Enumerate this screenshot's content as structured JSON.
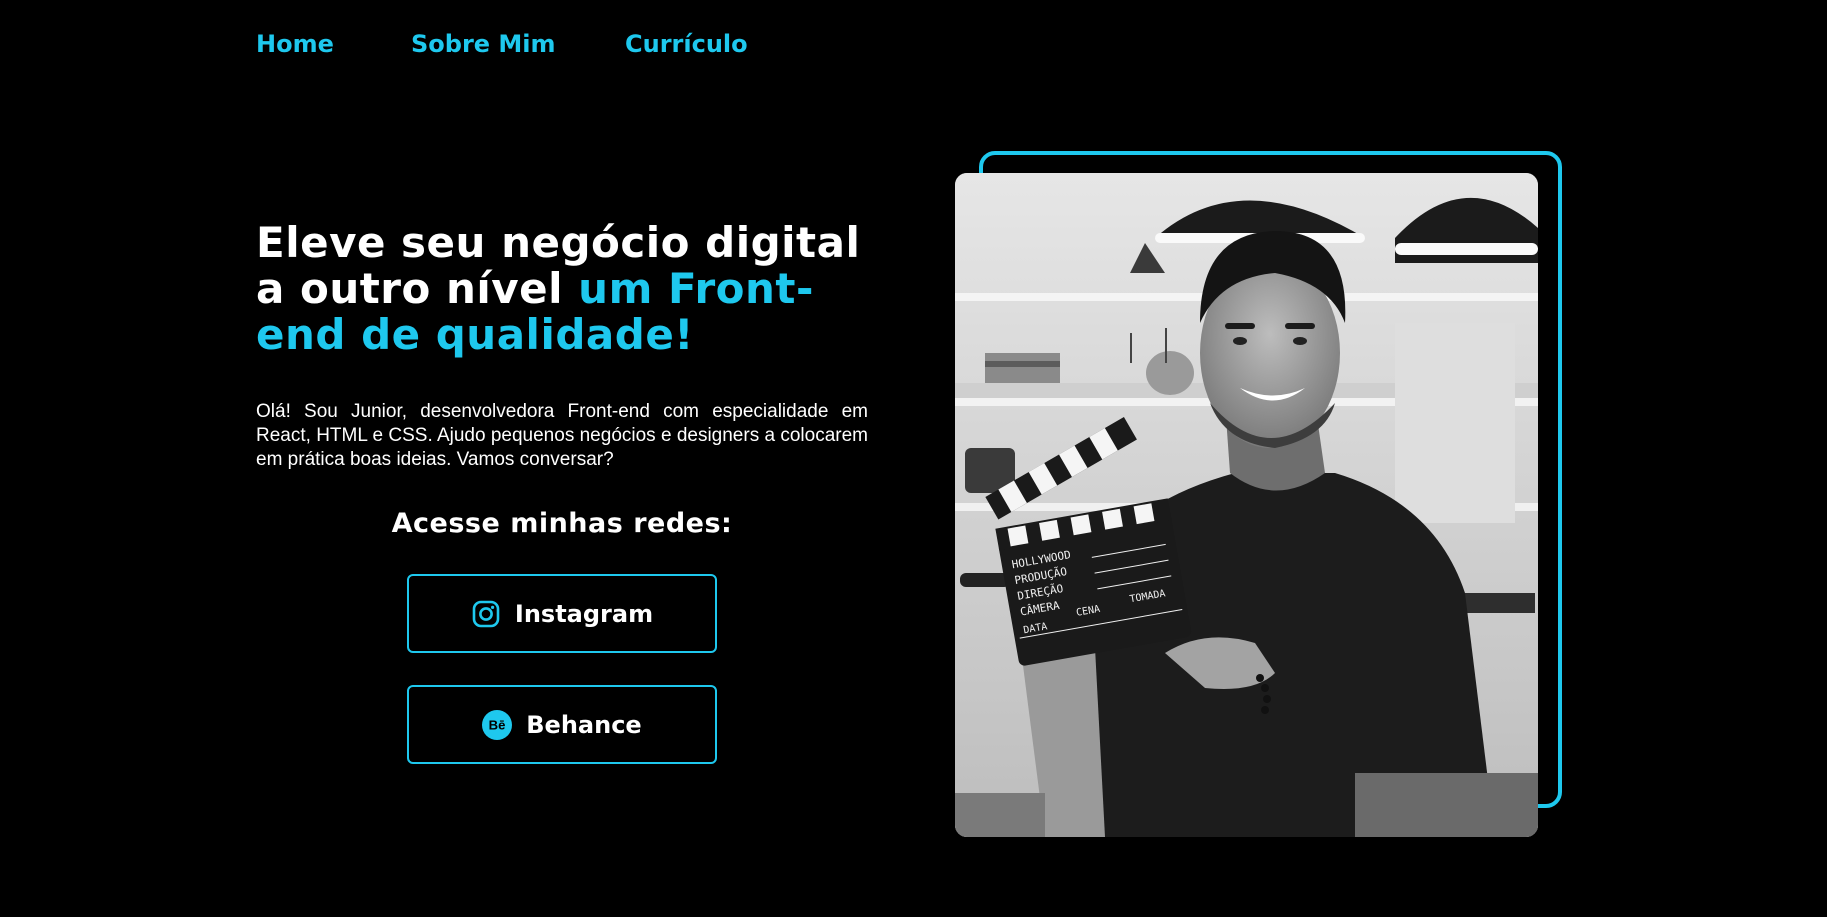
{
  "nav": {
    "items": [
      {
        "label": "Home"
      },
      {
        "label": "Sobre Mim"
      },
      {
        "label": "Currículo"
      }
    ]
  },
  "hero": {
    "title_part1": "Eleve seu negócio digital a outro nível ",
    "title_accent": "um Front-end de qualidade!",
    "description": "Olá! Sou Junior, desenvolvedora Front-end com especialidade em React, HTML e CSS. Ajudo pequenos negócios e designers a colocarem em prática boas ideias. Vamos conversar?"
  },
  "networks": {
    "title": "Acesse minhas redes:",
    "instagram": {
      "label": "Instagram",
      "icon": "instagram-icon"
    },
    "behance": {
      "label": "Behance",
      "icon": "behance-icon",
      "icon_text": "Bē"
    }
  },
  "photo": {
    "clapper_lines": [
      "HOLLYWOOD",
      "PRODUÇÃO",
      "DIREÇÃO",
      "CÂMERA",
      "DATA",
      "CENA",
      "TOMADA"
    ]
  },
  "colors": {
    "accent": "#1ec8ee",
    "background": "#000000",
    "text": "#ffffff"
  }
}
